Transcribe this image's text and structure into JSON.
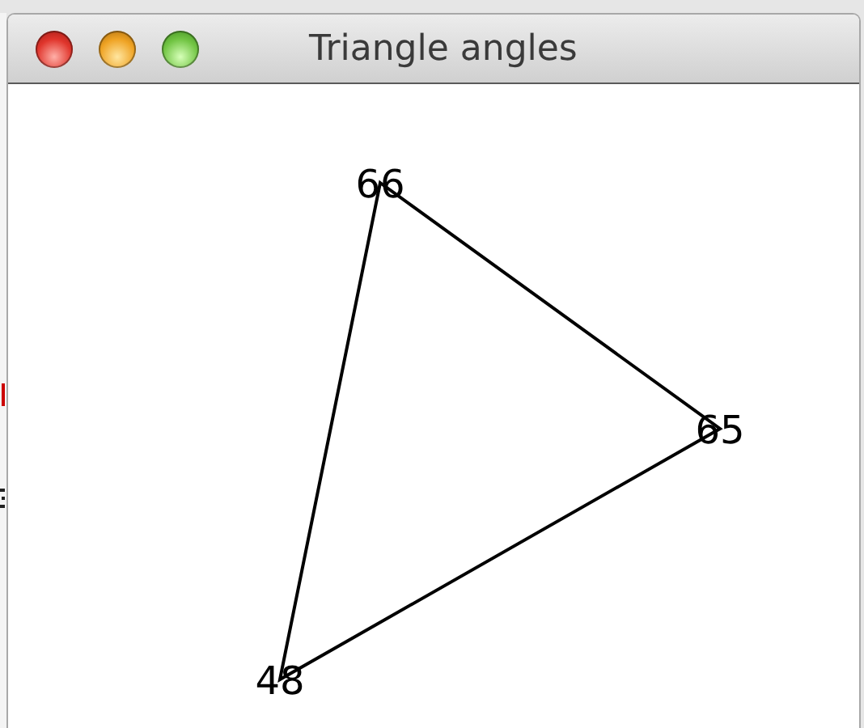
{
  "window": {
    "title": "Triangle angles"
  },
  "vertices": [
    {
      "label": "66"
    },
    {
      "label": "65"
    },
    {
      "label": "48"
    }
  ]
}
